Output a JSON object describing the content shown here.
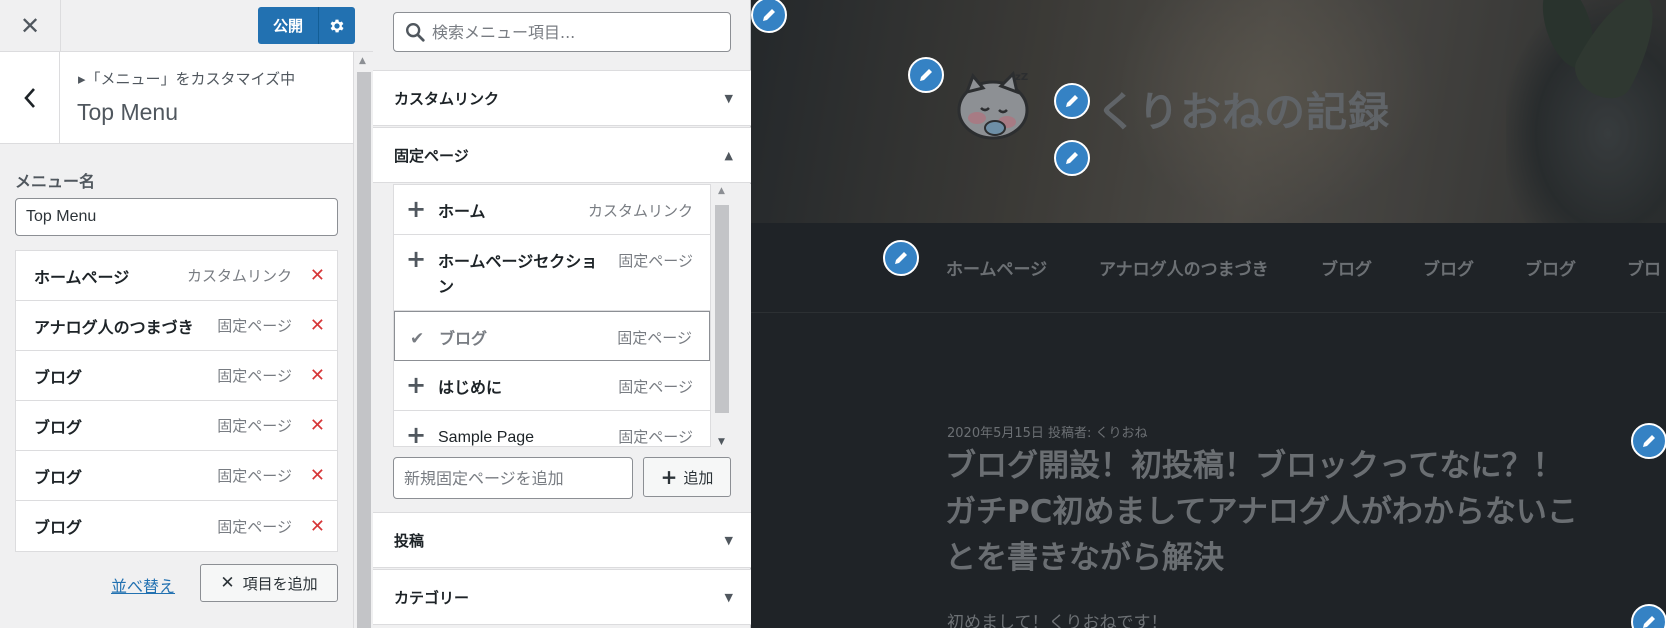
{
  "topbar": {
    "close_glyph": "✕",
    "publish_label": "公開"
  },
  "section": {
    "breadcrumb": "▸「メニュー」をカスタマイズ中",
    "title": "Top Menu"
  },
  "menu_name": {
    "label": "メニュー名",
    "value": "Top Menu"
  },
  "menu_items": [
    {
      "title": "ホームページ",
      "type": "カスタムリンク"
    },
    {
      "title": "アナログ人のつまづき",
      "type": "固定ページ"
    },
    {
      "title": "ブログ",
      "type": "固定ページ"
    },
    {
      "title": "ブログ",
      "type": "固定ページ"
    },
    {
      "title": "ブログ",
      "type": "固定ページ"
    },
    {
      "title": "ブログ",
      "type": "固定ページ"
    }
  ],
  "menu_actions": {
    "reorder": "並べ替え",
    "add_items": "項目を追加"
  },
  "items_panel": {
    "search_placeholder": "検索メニュー項目...",
    "sections": {
      "custom_link": "カスタムリンク",
      "pages": "固定ページ",
      "posts": "投稿",
      "categories": "カテゴリー"
    },
    "pages": [
      {
        "title": "ホーム",
        "type": "カスタムリンク",
        "added": false
      },
      {
        "title": "ホームページセクション",
        "type": "固定ページ",
        "added": false
      },
      {
        "title": "ブログ",
        "type": "固定ページ",
        "added": true
      },
      {
        "title": "はじめに",
        "type": "固定ページ",
        "added": false
      },
      {
        "title": "Sample Page",
        "type": "固定ページ",
        "added": false
      }
    ],
    "new_page_placeholder": "新規固定ページを追加",
    "add_label": "追加"
  },
  "preview": {
    "site_title": "くりおねの記録",
    "nav": [
      "ホームページ",
      "アナログ人のつまづき",
      "ブログ",
      "ブログ",
      "ブログ",
      "ブロ"
    ],
    "post_meta": "2020年5月15日 投稿者: くりおね",
    "post_title": "ブログ開設！初投稿！ブロックってなに？！ガチPC初めましてアナログ人がわからないことを書きながら解決",
    "post_excerpt": "初めまして！くりおねです！"
  },
  "colors": {
    "accent": "#2271b1",
    "remove": "#d63638",
    "edit_shortcut": "#3582c4",
    "preview_bg": "#1f2327"
  }
}
